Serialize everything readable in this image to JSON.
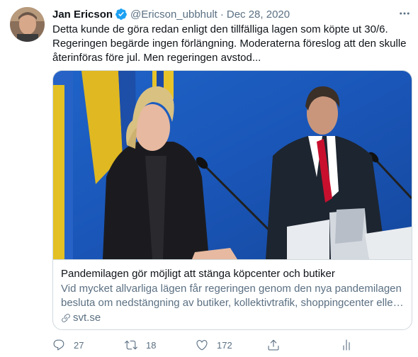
{
  "tweet": {
    "author_name": "Jan Ericson",
    "handle": "@Ericson_ubbhult",
    "separator": "·",
    "date": "Dec 28, 2020",
    "text": "Detta kunde de göra redan enligt den tillfälliga lagen som köpte ut 30/6. Regeringen begärde ingen förlängning. Moderaterna föreslog att den skulle återinföras före jul. Men regeringen avstod..."
  },
  "card": {
    "title": "Pandemilagen gör möjligt att stänga köpcenter och butiker",
    "description_line1": "Vid mycket allvarliga lägen får regeringen genom den nya pandemilagen",
    "description_line2": "besluta om nedstängning av butiker, kollektivtrafik, shoppingcenter elle…",
    "domain": "svt.se"
  },
  "actions": {
    "replies": "27",
    "retweets": "18",
    "likes": "172"
  },
  "icons": {
    "verified": "verified-badge-icon",
    "more": "more-horizontal-icon",
    "link": "link-icon",
    "reply": "reply-icon",
    "retweet": "retweet-icon",
    "like": "heart-icon",
    "share": "share-icon",
    "analytics": "analytics-icon"
  },
  "colors": {
    "primary_text": "#0f1419",
    "secondary_text": "#5b7083",
    "verified_blue": "#1da1f2",
    "border": "#cfd9de",
    "backdrop_blue": "#1a56b8"
  }
}
